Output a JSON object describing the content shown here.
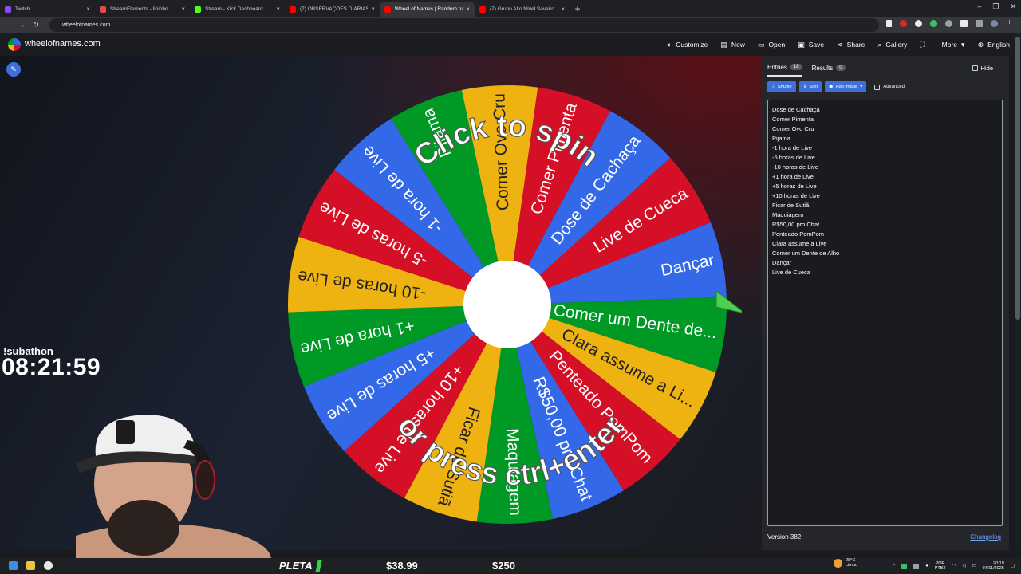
{
  "browser": {
    "tabs": [
      {
        "label": "Twitch",
        "color": "#9146ff",
        "active": false
      },
      {
        "label": "StreamElements - lipinho",
        "color": "#e64a4a",
        "active": false
      },
      {
        "label": "Stream - Kick Dashboard",
        "color": "#53fc18",
        "active": false
      },
      {
        "label": "(7) OBSERVAÇÕES DIÁRIAS (EP",
        "color": "#ff0000",
        "active": false
      },
      {
        "label": "Wheel of Names | Random nam",
        "color": "#ff0000",
        "active": true
      },
      {
        "label": "(7) Grupo Alto Nível Saveiro",
        "color": "#ff0000",
        "active": false
      }
    ],
    "new_tab": "+",
    "url": "wheelofnames.com"
  },
  "header": {
    "brand": "wheelofnames.com",
    "menu": [
      {
        "icon": "palette-icon",
        "glyph": "◐",
        "label": "Customize"
      },
      {
        "icon": "new-file-icon",
        "glyph": "▤",
        "label": "New"
      },
      {
        "icon": "folder-icon",
        "glyph": "▭",
        "label": "Open"
      },
      {
        "icon": "save-icon",
        "glyph": "▣",
        "label": "Save"
      },
      {
        "icon": "share-icon",
        "glyph": "⋖",
        "label": "Share"
      },
      {
        "icon": "search-icon",
        "glyph": "⌕",
        "label": "Gallery"
      },
      {
        "icon": "fullscreen-icon",
        "glyph": "⛶",
        "label": ""
      },
      {
        "icon": "chevron-down-icon",
        "glyph": "▾",
        "label": "More"
      },
      {
        "icon": "globe-icon",
        "glyph": "⊕",
        "label": "English"
      }
    ]
  },
  "wheel": {
    "overlay_top": "Click to spin",
    "overlay_bottom": "or press ctrl+enter",
    "segments": [
      {
        "label": "Comer um Dente de...",
        "color": "#009925"
      },
      {
        "label": "Clara assume a Li...",
        "color": "#eeb211"
      },
      {
        "label": "Penteado PomPom",
        "color": "#d50f25"
      },
      {
        "label": "R$50,00 pro Chat",
        "color": "#3369e8"
      },
      {
        "label": "Maquiagem",
        "color": "#009925"
      },
      {
        "label": "Ficar de Sutiã",
        "color": "#eeb211"
      },
      {
        "label": "+10 horas de Live",
        "color": "#d50f25"
      },
      {
        "label": "+5 horas de Live",
        "color": "#3369e8"
      },
      {
        "label": "+1 hora de Live",
        "color": "#009925"
      },
      {
        "label": "-10 horas de Live",
        "color": "#eeb211"
      },
      {
        "label": "-5 horas de Live",
        "color": "#d50f25"
      },
      {
        "label": "-1 hora de Live",
        "color": "#3369e8"
      },
      {
        "label": "Pijama",
        "color": "#009925"
      },
      {
        "label": "Comer Ovo Cru",
        "color": "#eeb211"
      },
      {
        "label": "Comer Pimenta",
        "color": "#d50f25"
      },
      {
        "label": "Dose de Cachaça",
        "color": "#3369e8"
      },
      {
        "label": "Live de Cueca",
        "color": "#d50f25"
      },
      {
        "label": "Dançar",
        "color": "#3369e8"
      }
    ]
  },
  "panel": {
    "tabs": [
      {
        "label": "Entries",
        "count": "18"
      },
      {
        "label": "Results",
        "count": "0"
      }
    ],
    "hide_label": "Hide",
    "tools": {
      "shuffle": "Shuffle",
      "sort": "Sort",
      "add_image": "Add image",
      "advanced": "Advanced"
    },
    "entries": [
      "Dose de Cachaça",
      "Comer Pimenta",
      "Comer Ovo Cru",
      "Pijama",
      "-1 hora de Live",
      "-5 horas de Live",
      "-10 horas de Live",
      "+1 hora de Live",
      "+5 horas de Live",
      "+10 horas de Live",
      "Ficar de Sutiã",
      "Maquiagem",
      "R$50,00 pro Chat",
      "Penteado PomPom",
      "Clara assume a Live",
      "Comer um Dente de Alho",
      "Dançar",
      "Live de Cueca"
    ],
    "version": "Version 382",
    "changelog": "Changelog"
  },
  "stream": {
    "subathon_label": "!subathon",
    "timer": "08:21:59",
    "ticker_label": "PLETA",
    "ticker_values": [
      "$38.99",
      "$250"
    ]
  },
  "taskbar": {
    "weather_temp": "28°C",
    "weather_desc": "Limpo",
    "lang_top": "POR",
    "lang_bottom": "PTB2",
    "time": "20:19",
    "date": "07/11/2025"
  }
}
